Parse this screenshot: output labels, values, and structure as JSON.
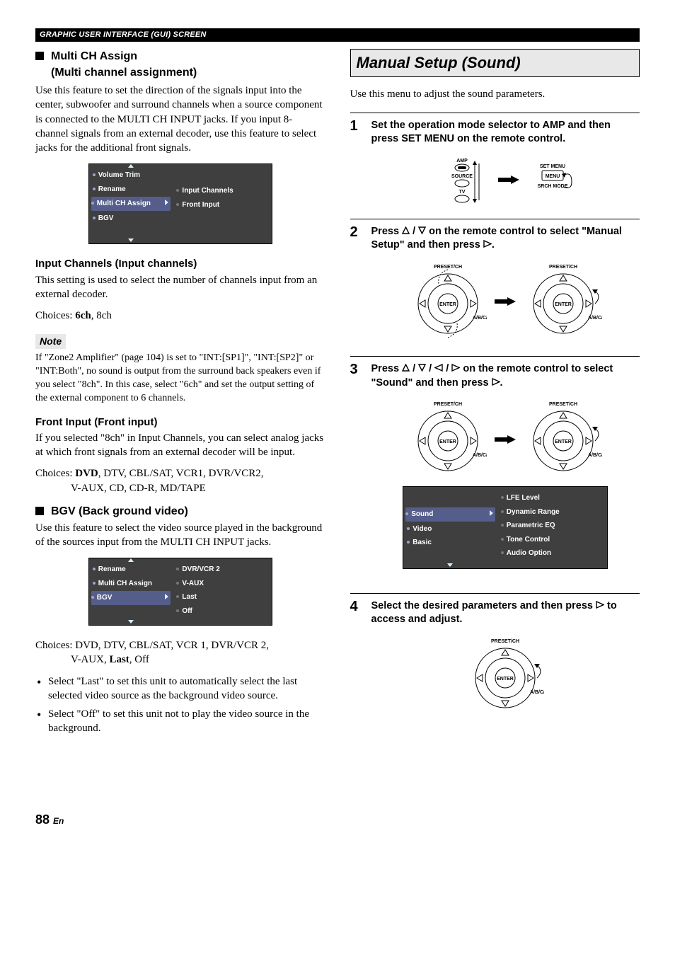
{
  "header": {
    "section_label": "GRAPHIC USER INTERFACE (GUI) SCREEN"
  },
  "left": {
    "multi_ch": {
      "title": "Multi CH Assign",
      "subtitle": "(Multi channel assignment)",
      "intro": "Use this feature to set the direction of the signals input into the center, subwoofer and surround channels when a source component is connected to the MULTI CH INPUT jacks. If you input 8-channel signals from an external decoder, use this feature to select jacks for the additional front signals.",
      "menu": {
        "left": [
          "Volume Trim",
          "Rename",
          "Multi CH Assign",
          "BGV"
        ],
        "selected_index": 2,
        "right": [
          "Input Channels",
          "Front Input"
        ]
      },
      "input_channels": {
        "heading": "Input Channels (Input channels)",
        "text": "This setting is used to select the number of channels input from an external decoder.",
        "choices_prefix": "Choices: ",
        "choices_bold": "6ch",
        "choices_rest": ", 8ch"
      },
      "note_label": "Note",
      "note_text": "If \"Zone2 Amplifier\" (page 104) is set to \"INT:[SP1]\", \"INT:[SP2]\" or \"INT:Both\", no sound is output from the surround back speakers even if you select \"8ch\". In this case, select \"6ch\" and set the output setting of the external component to 6 channels.",
      "front_input": {
        "heading": "Front Input (Front input)",
        "text": "If you selected \"8ch\" in Input Channels, you can select analog jacks at which front signals from an external decoder will be input.",
        "choices_prefix": "Choices: ",
        "choices_bold": "DVD",
        "choices_rest": ", DTV, CBL/SAT, VCR1, DVR/VCR2,",
        "choices_line2": "V-AUX, CD, CD-R, MD/TAPE"
      }
    },
    "bgv": {
      "title": "BGV (Back ground video)",
      "intro": "Use this feature to select the video source played in the background of the sources input from the MULTI CH INPUT jacks.",
      "menu": {
        "left": [
          "Rename",
          "Multi CH Assign",
          "BGV"
        ],
        "selected_index": 2,
        "right": [
          "DVR/VCR 2",
          "V-AUX",
          "Last",
          "Off"
        ]
      },
      "choices_prefix": "Choices: DVD, DTV, CBL/SAT, VCR 1, DVR/VCR 2,",
      "choices_line2_pre": "V-AUX, ",
      "choices_line2_bold": "Last",
      "choices_line2_post": ", Off",
      "bullets": [
        "Select \"Last\" to set this unit to automatically select the last selected video source as the background video source.",
        "Select \"Off\" to set this unit not to play the video source in the background."
      ]
    }
  },
  "right": {
    "title": "Manual Setup (Sound)",
    "intro": "Use this menu to adjust the sound parameters.",
    "steps": {
      "s1": {
        "num": "1",
        "text": "Set the operation mode selector to AMP and then press SET MENU on the remote control."
      },
      "s2": {
        "num": "2",
        "text_pre": "Press ",
        "text_mid": " on the remote control to select \"Manual Setup\" and then press ",
        "text_post": "."
      },
      "s3": {
        "num": "3",
        "text_pre": "Press ",
        "text_mid": " on the remote control to select \"Sound\" and then press ",
        "text_post": "."
      },
      "s4": {
        "num": "4",
        "text_pre": "Select the desired parameters and then press ",
        "text_post": " to access and adjust."
      }
    },
    "amp_labels": {
      "amp": "AMP",
      "source": "SOURCE",
      "tv": "TV",
      "setmenu": "SET MENU",
      "menu": "MENU",
      "srch": "SRCH MODE"
    },
    "pad_labels": {
      "preset": "PRESET/CH",
      "enter": "ENTER",
      "abcde": "A/B/C/D/E"
    },
    "sound_menu": {
      "left": [
        "Sound",
        "Video",
        "Basic"
      ],
      "selected_index": 0,
      "right": [
        "LFE Level",
        "Dynamic Range",
        "Parametric EQ",
        "Tone Control",
        "Audio Option"
      ]
    }
  },
  "page": {
    "number": "88",
    "suffix": "En"
  }
}
